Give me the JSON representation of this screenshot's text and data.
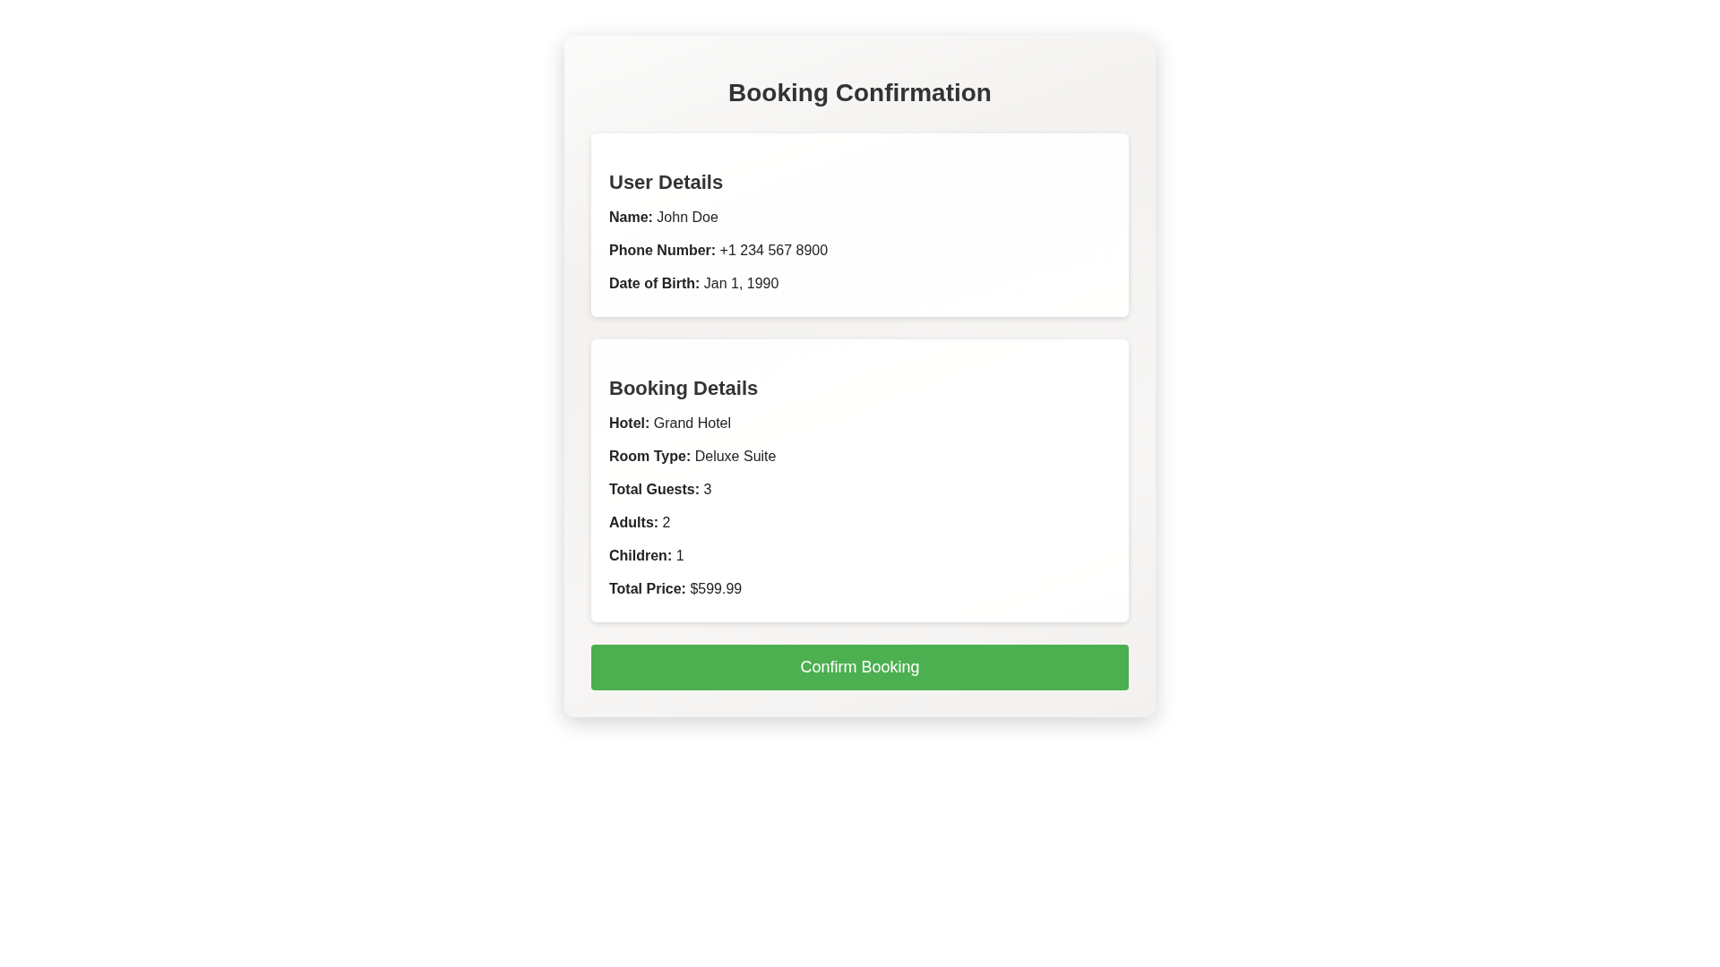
{
  "title": "Booking Confirmation",
  "sections": [
    {
      "title": "User Details",
      "fields": [
        {
          "label": "Name:",
          "value": "John Doe"
        },
        {
          "label": "Phone Number:",
          "value": "+1 234 567 8900"
        },
        {
          "label": "Date of Birth:",
          "value": "Jan 1, 1990"
        }
      ]
    },
    {
      "title": "Booking Details",
      "fields": [
        {
          "label": "Hotel:",
          "value": "Grand Hotel"
        },
        {
          "label": "Room Type:",
          "value": "Deluxe Suite"
        },
        {
          "label": "Total Guests:",
          "value": "3"
        },
        {
          "label": "Adults:",
          "value": "2"
        },
        {
          "label": "Children:",
          "value": "1"
        },
        {
          "label": "Total Price:",
          "value": "$599.99"
        }
      ]
    }
  ],
  "button": {
    "label": "Confirm Booking"
  }
}
